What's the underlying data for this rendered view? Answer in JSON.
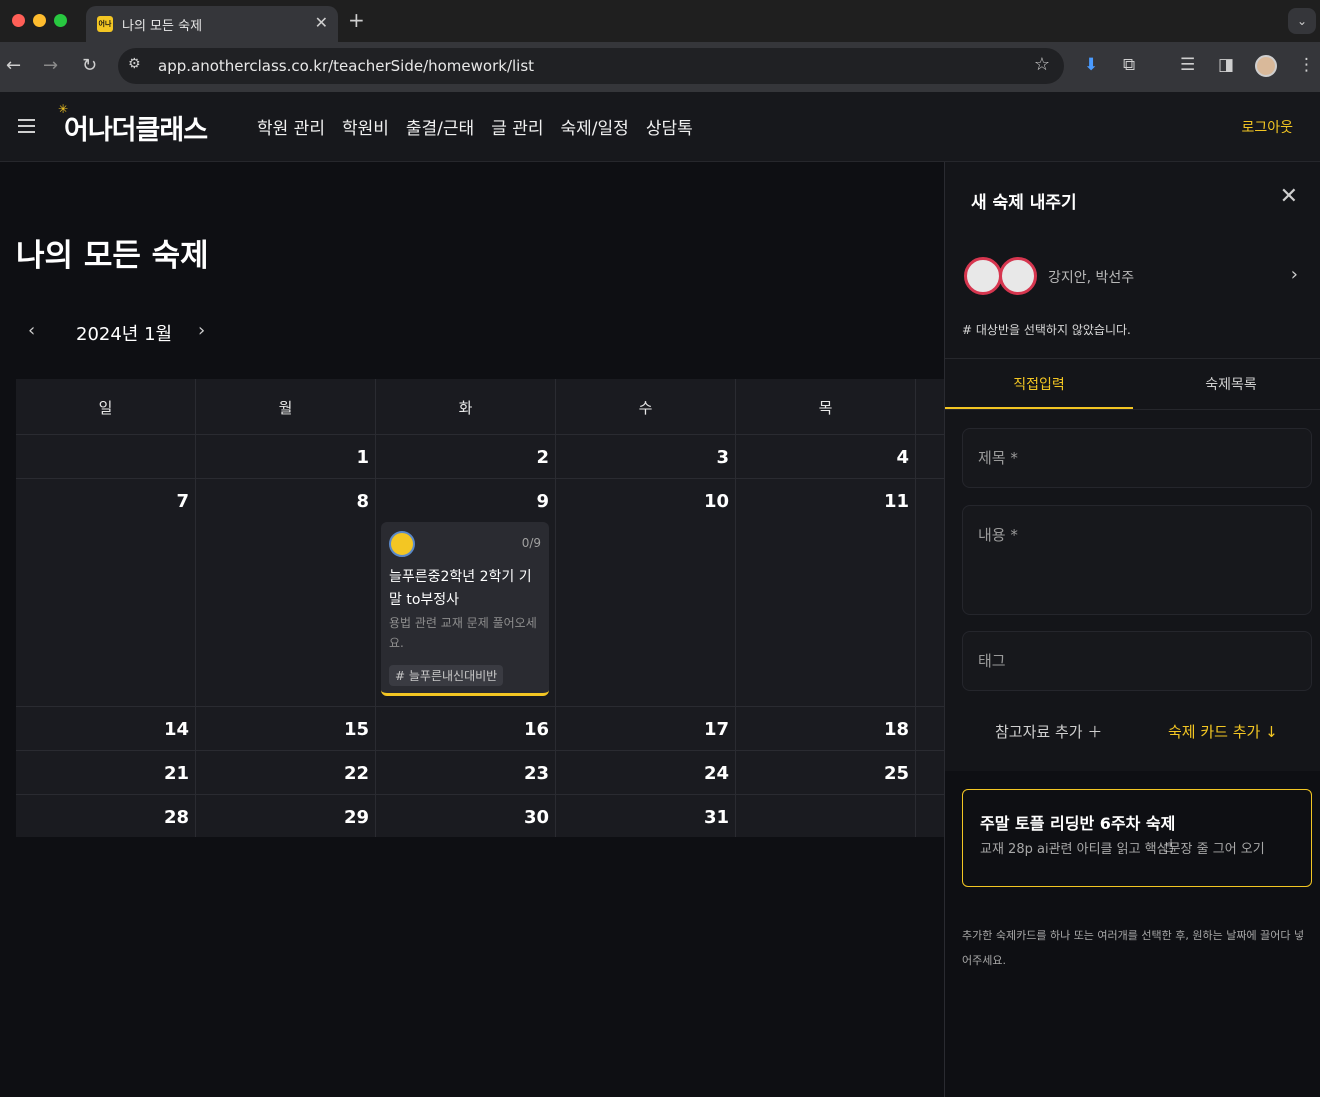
{
  "browser": {
    "tab_title": "나의 모든 숙제",
    "favicon_text": "어나",
    "url": "app.anotherclass.co.kr/teacherSide/homework/list"
  },
  "app": {
    "logo": "어나더클래스",
    "nav": [
      "학원 관리",
      "학원비",
      "출결/근태",
      "글 관리",
      "숙제/일정",
      "상담톡"
    ],
    "logout": "로그아웃",
    "accent_color": "#f3c623"
  },
  "main": {
    "page_title": "나의 모든 숙제",
    "month_label": "2024년 1월",
    "weekdays": [
      "일",
      "월",
      "화",
      "수",
      "목"
    ],
    "weeks": [
      [
        "",
        "1",
        "2",
        "3",
        "4"
      ],
      [
        "7",
        "8",
        "9",
        "10",
        "11"
      ],
      [
        "14",
        "15",
        "16",
        "17",
        "18"
      ],
      [
        "21",
        "22",
        "23",
        "24",
        "25"
      ],
      [
        "28",
        "29",
        "30",
        "31",
        ""
      ]
    ],
    "homework_card": {
      "count": "0/9",
      "title": "늘푸른중2학년 2학기 기말 to부정사",
      "desc": "용법 관련 교재 문제 풀어오세요.",
      "tag": "# 늘푸른내신대비반"
    }
  },
  "panel": {
    "title": "새 숙제 내주기",
    "students": "강지안, 박선주",
    "no_class_note": "# 대상반을 선택하지 않았습니다.",
    "tabs": [
      "직접입력",
      "숙제목록"
    ],
    "title_placeholder": "제목 *",
    "content_placeholder": "내용 *",
    "tag_placeholder": "태그",
    "ref_label": "참고자료 추가 ＋",
    "add_card_label": "숙제 카드 추가 ↓",
    "draft_card": {
      "title": "주말 토플 리딩반 6주차 숙제",
      "desc": "교재 28p ai관련 아티클 읽고 핵심문장 줄 그어 오기"
    },
    "help_text": "추가한 숙제카드를 하나 또는 여러개를 선택한 후, 원하는 날짜에 끌어다 넣어주세요."
  }
}
